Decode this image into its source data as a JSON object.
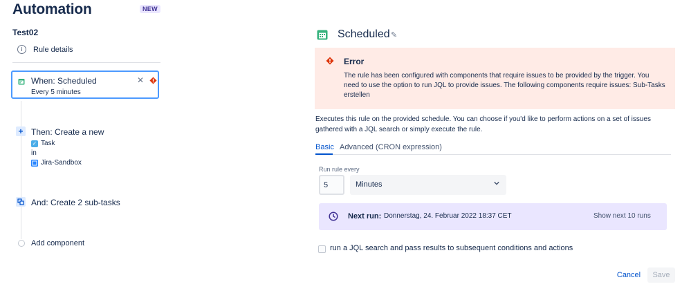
{
  "header": {
    "title": "Automation",
    "badge": "NEW"
  },
  "sidebar": {
    "rule_name": "Test02",
    "rule_details_label": "Rule details",
    "trigger": {
      "title": "When: Scheduled",
      "subtitle": "Every 5 minutes"
    },
    "action1": {
      "title": "Then: Create a new",
      "issue_type": "Task",
      "in_label": "in",
      "project": "Jira-Sandbox"
    },
    "action2": {
      "title": "And: Create 2 sub-tasks"
    },
    "add_component": "Add component"
  },
  "panel": {
    "title": "Scheduled",
    "error": {
      "title": "Error",
      "message": "The rule has been configured with components that require issues to be provided by the trigger. You need to use the option to run JQL to provide issues. The following components require issues: Sub-Tasks erstellen"
    },
    "description": "Executes this rule on the provided schedule. You can choose if you'd like to perform actions on a set of issues gathered with a JQL search or simply execute the rule.",
    "tabs": [
      {
        "label": "Basic"
      },
      {
        "label": "Advanced (CRON expression)"
      }
    ],
    "run_rule_label": "Run rule every",
    "interval_value": "5",
    "interval_unit": "Minutes",
    "next_run_label": "Next run:",
    "next_run_value": "Donnerstag, 24. Februar 2022 18:37 CET",
    "show_next_label": "Show next 10 runs",
    "jql_option_label": "run a JQL search and pass results to subsequent conditions and actions",
    "cancel_label": "Cancel",
    "save_label": "Save"
  },
  "colors": {
    "accent": "#0052cc",
    "error_bg": "#ffebe6",
    "error_icon": "#de350b",
    "next_run_bg": "#eae6ff",
    "focus_border": "#4c9aff"
  }
}
